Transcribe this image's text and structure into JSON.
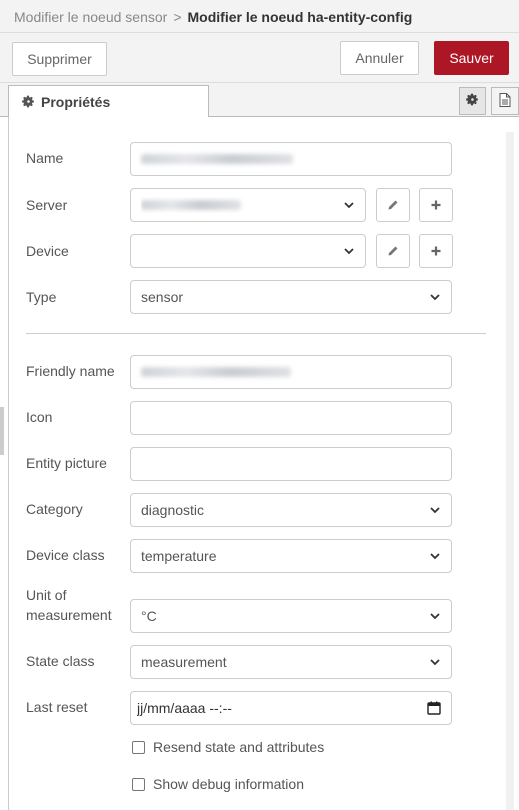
{
  "breadcrumb": {
    "parent": "Modifier le noeud sensor",
    "separator": ">",
    "current": "Modifier le noeud ha-entity-config"
  },
  "toolbar": {
    "delete_label": "Supprimer",
    "cancel_label": "Annuler",
    "save_label": "Sauver",
    "save_color": "#ad1625"
  },
  "tabs": {
    "properties_label": "Propriétés",
    "properties_icon": "gear-icon",
    "icon_tabs": [
      "gear-icon",
      "document-icon"
    ]
  },
  "form": {
    "name": {
      "label": "Name",
      "value": ""
    },
    "server": {
      "label": "Server",
      "value": ""
    },
    "device": {
      "label": "Device",
      "value": ""
    },
    "type": {
      "label": "Type",
      "value": "sensor"
    },
    "friendly_name": {
      "label": "Friendly name",
      "value": ""
    },
    "icon": {
      "label": "Icon",
      "value": ""
    },
    "entity_picture": {
      "label": "Entity picture",
      "value": ""
    },
    "category": {
      "label": "Category",
      "value": "diagnostic"
    },
    "device_class": {
      "label": "Device class",
      "value": "temperature"
    },
    "unit_of_measurement": {
      "label_line1": "Unit of",
      "label_line2": "measurement",
      "value": "°C"
    },
    "state_class": {
      "label": "State class",
      "value": "measurement"
    },
    "last_reset": {
      "label": "Last reset",
      "value": "jj/mm/aaaa  --:--"
    },
    "resend_state": {
      "label": "Resend state and attributes",
      "checked": false
    },
    "show_debug": {
      "label": "Show debug information",
      "checked": false
    }
  }
}
